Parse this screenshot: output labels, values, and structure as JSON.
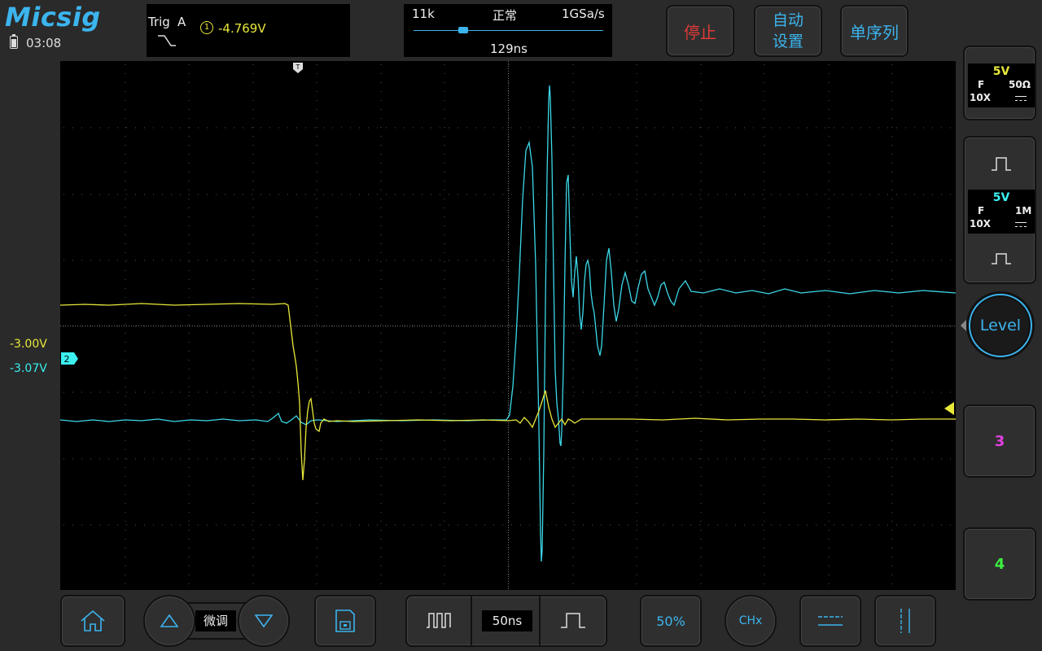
{
  "app": {
    "brand": "Micsig",
    "time": "03:08"
  },
  "trigger": {
    "label": "Trig",
    "source": "A",
    "channel_num": "1",
    "level": "-4.769V"
  },
  "timebase_status": {
    "depth": "11k",
    "mode": "正常",
    "sample_rate": "1GSa/s",
    "delay": "129ns"
  },
  "top_buttons": {
    "stop": "停止",
    "auto_line1": "自动",
    "auto_line2": "设置",
    "single": "单序列"
  },
  "offsets": {
    "ch1": "-3.00V",
    "ch2": "-3.07V",
    "ch2_marker": "2"
  },
  "channels": {
    "ch1": {
      "scale": "5V",
      "coupling": "F",
      "impedance": "50Ω",
      "probe": "10X",
      "color": "#e8e83a"
    },
    "ch2": {
      "scale": "5V",
      "coupling": "F",
      "impedance": "1M",
      "probe": "10X",
      "color": "#3cf0f0"
    },
    "ch3": {
      "label": "3",
      "color": "#e040e0"
    },
    "ch4": {
      "label": "4",
      "color": "#3cf040"
    }
  },
  "level_button": "Level",
  "bottom": {
    "fine": "微调",
    "timebase": "50ns",
    "fifty": "50%",
    "chx": "CHx"
  },
  "colors": {
    "accent": "#3cb4ee",
    "ch1": "#e8e83a",
    "ch2": "#3cf0f0",
    "stop": "#e03a3a"
  },
  "icons": [
    "home-icon",
    "arrow-up-icon",
    "arrow-down-icon",
    "save-icon",
    "timebase-decrease-icon",
    "timebase-increase-icon",
    "horizontal-cursor-icon",
    "vertical-cursor-icon",
    "pulse-icon",
    "falling-edge-icon"
  ]
}
